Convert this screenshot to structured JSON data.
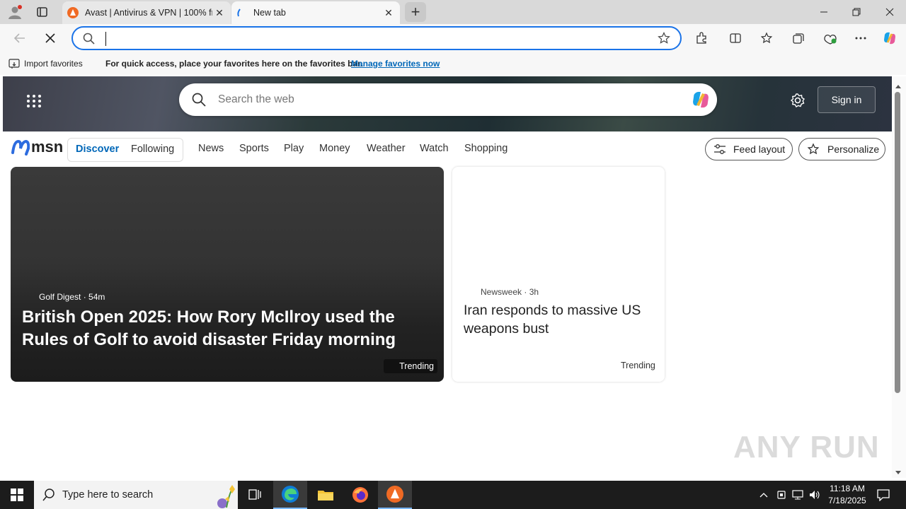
{
  "browser": {
    "tabs": [
      {
        "title": "Avast | Antivirus & VPN | 100% free",
        "close": "✕"
      },
      {
        "title": "New tab",
        "close": "✕"
      }
    ],
    "newtab_symbol": "+",
    "address_value": "",
    "favorites_bar": {
      "import_label": "Import favorites",
      "message": "For quick access, place your favorites here on the favorites bar.",
      "manage_link": "Manage favorites now"
    }
  },
  "msn": {
    "search_placeholder": "Search the web",
    "sign_in": "Sign in",
    "logo_text": "msn",
    "segment": [
      "Discover",
      "Following"
    ],
    "nav": [
      "News",
      "Sports",
      "Play",
      "Money",
      "Weather",
      "Watch",
      "Shopping"
    ],
    "feed_layout": "Feed layout",
    "personalize": "Personalize",
    "cards": [
      {
        "source": "Golf Digest",
        "age": "54m",
        "headline": "British Open 2025: How Rory McIlroy used the Rules of Golf to avoid disaster Friday morning",
        "tag": "Trending"
      },
      {
        "source": "Newsweek",
        "age": "3h",
        "headline": "Iran responds to massive US weapons bust",
        "tag": "Trending"
      }
    ],
    "watermark": "ANY RUN"
  },
  "taskbar": {
    "search_placeholder": "Type here to search",
    "time": "11:18 AM",
    "date": "7/18/2025"
  },
  "colors": {
    "accent": "#1a73e8",
    "msn_blue": "#0067b8",
    "taskbar": "#1c1c1c"
  }
}
